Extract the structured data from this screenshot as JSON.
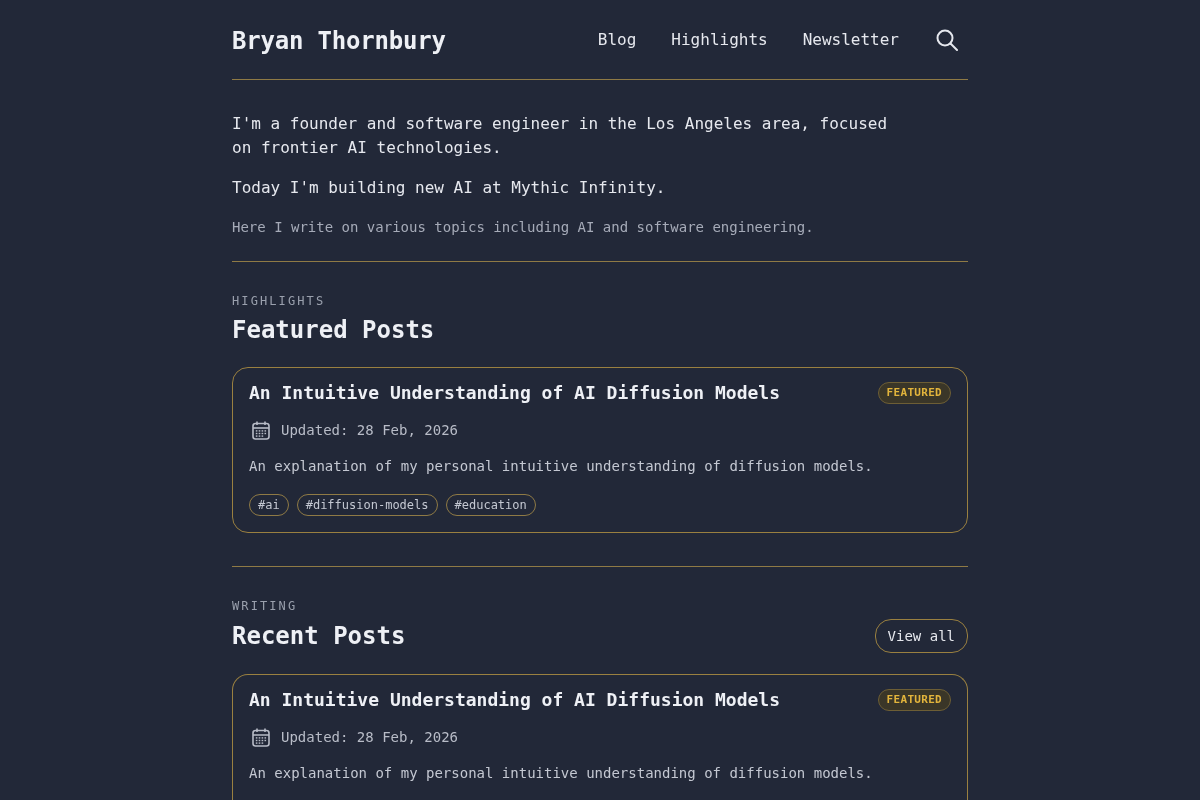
{
  "header": {
    "site_title": "Bryan Thornbury",
    "nav": [
      {
        "label": "Blog"
      },
      {
        "label": "Highlights"
      },
      {
        "label": "Newsletter"
      }
    ]
  },
  "intro": {
    "paragraphs": [
      "I'm a founder and software engineer in the Los Angeles area, focused on frontier AI technologies.",
      "Today I'm building new AI at Mythic Infinity."
    ],
    "note": "Here I write on various topics including AI and software engineering."
  },
  "featured": {
    "eyebrow": "HIGHLIGHTS",
    "title": "Featured Posts",
    "posts": [
      {
        "title": "An Intuitive Understanding of AI Diffusion Models",
        "badge": "FEATURED",
        "date": "Updated: 28 Feb, 2026",
        "summary": "An explanation of my personal intuitive understanding of diffusion models.",
        "tags": [
          "#ai",
          "#diffusion-models",
          "#education"
        ]
      }
    ]
  },
  "recent": {
    "eyebrow": "WRITING",
    "title": "Recent Posts",
    "view_all": "View all",
    "posts": [
      {
        "title": "An Intuitive Understanding of AI Diffusion Models",
        "badge": "FEATURED",
        "date": "Updated: 28 Feb, 2026",
        "summary": "An explanation of my personal intuitive understanding of diffusion models."
      }
    ]
  }
}
